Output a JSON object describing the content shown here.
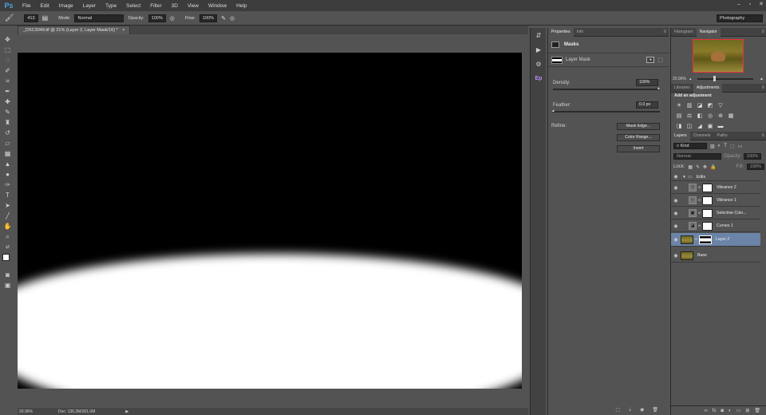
{
  "app": {
    "logo": "Ps"
  },
  "menu": [
    "File",
    "Edit",
    "Image",
    "Layer",
    "Type",
    "Select",
    "Filter",
    "3D",
    "View",
    "Window",
    "Help"
  ],
  "window_buttons": [
    "–",
    "▫",
    "✕"
  ],
  "options": {
    "brush_size": "413",
    "mode_label": "Mode:",
    "mode_value": "Normal",
    "opacity_label": "Opacity:",
    "opacity_value": "100%",
    "flow_label": "Flow:",
    "flow_value": "100%",
    "workspace": "Photography"
  },
  "document": {
    "tab_title": "_DSC3049.tif @ 21% (Layer 2, Layer Mask/16) *",
    "close_glyph": "×"
  },
  "status": {
    "zoom": "20.96%",
    "doc": "Doc: 136.2M/301.0M"
  },
  "properties": {
    "tabs": [
      "Properties",
      "Info"
    ],
    "section": "Masks",
    "mask_name": "Layer Mask",
    "density_label": "Density:",
    "density_value": "100%",
    "feather_label": "Feather:",
    "feather_value": "0.0 px",
    "refine_label": "Refine:",
    "buttons": [
      "Mask Edge...",
      "Color Range...",
      "Invert"
    ]
  },
  "navigator": {
    "tabs": [
      "Histogram",
      "Navigator"
    ],
    "zoom": "20.96%"
  },
  "adjustments": {
    "tabs": [
      "Libraries",
      "Adjustments"
    ],
    "title": "Add an adjustment"
  },
  "layers": {
    "tabs": [
      "Layers",
      "Channels",
      "Paths"
    ],
    "kind_label": "Kind",
    "blend_mode": "Normal",
    "opacity_label": "Opacity:",
    "opacity_value": "100%",
    "lock_label": "Lock:",
    "fill_label": "Fill:",
    "fill_value": "100%",
    "group_name": "Edits",
    "items": [
      {
        "name": "Vibrance 2"
      },
      {
        "name": "Vibrance 1"
      },
      {
        "name": "Selective Colo..."
      },
      {
        "name": "Curves 1"
      },
      {
        "name": "Layer 2"
      },
      {
        "name": "Base"
      }
    ]
  },
  "colors": {
    "accent": "#6b84a8",
    "canvas_bg": "#000000",
    "mask_white": "#ffffff"
  }
}
